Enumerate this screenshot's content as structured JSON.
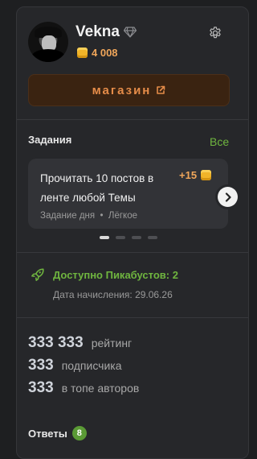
{
  "profile": {
    "username": "Vekna",
    "coins": "4 008",
    "shop_label": "магазин"
  },
  "tasks": {
    "title": "Задания",
    "all_link": "Все",
    "card": {
      "text": "Прочитать 10 постов в ленте любой Темы",
      "reward": "+15",
      "meta": "Задание дня  •  Лёгкое"
    },
    "pagination": {
      "count": 4,
      "active": 0
    }
  },
  "boost": {
    "title": "Доступно Пикабустов: 2",
    "date": "Дата начисления: 29.06.26"
  },
  "stats": [
    {
      "value": "333 333",
      "label": "рейтинг"
    },
    {
      "value": "333",
      "label": "подписчика"
    },
    {
      "value": "333",
      "label": "в топе авторов"
    }
  ],
  "answers": {
    "title": "Ответы",
    "count": "8"
  },
  "colors": {
    "accent_green": "#6fb53f",
    "accent_orange": "#e58c49",
    "coin_gold": "#f0b429"
  }
}
